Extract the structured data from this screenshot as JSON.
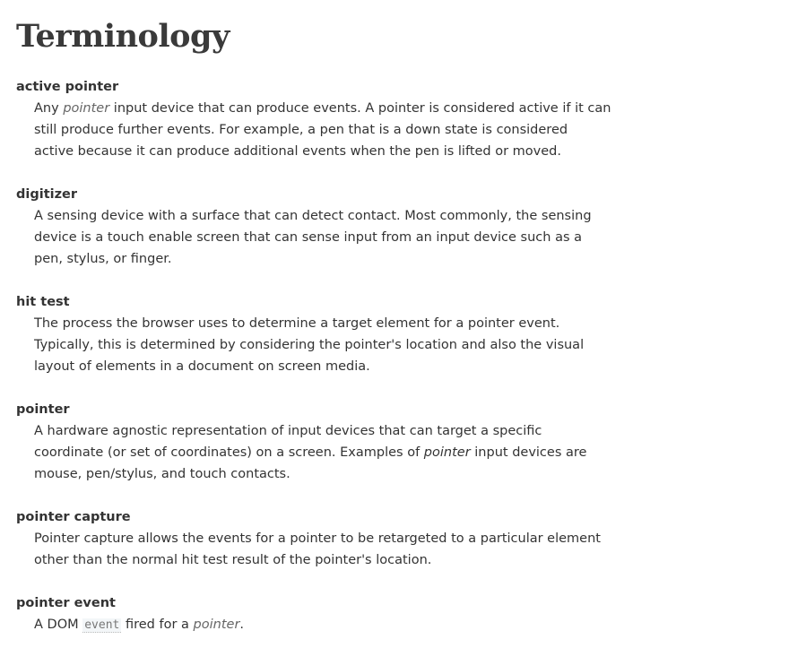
{
  "title": "Terminology",
  "terms": [
    {
      "term": "active pointer",
      "lines": [
        [
          {
            "t": "Any "
          },
          {
            "t": "pointer",
            "s": "link"
          },
          {
            "t": " input device that can produce events. A pointer is considered active if it can"
          }
        ],
        [
          {
            "t": "still produce further events. For example, a pen that is a down state is considered"
          }
        ],
        [
          {
            "t": "active because it can produce additional events when the pen is lifted or moved."
          }
        ]
      ]
    },
    {
      "term": "digitizer",
      "lines": [
        [
          {
            "t": "A sensing device with a surface that can detect contact. Most commonly, the sensing"
          }
        ],
        [
          {
            "t": "device is a touch enable screen that can sense input from an input device such as a"
          }
        ],
        [
          {
            "t": "pen, stylus, or finger."
          }
        ]
      ]
    },
    {
      "term": "hit test",
      "lines": [
        [
          {
            "t": "The process the browser uses to determine a target element for a pointer event."
          }
        ],
        [
          {
            "t": "Typically, this is determined by considering the pointer's location and also the visual"
          }
        ],
        [
          {
            "t": "layout of elements in a document on screen media."
          }
        ]
      ]
    },
    {
      "term": "pointer",
      "lines": [
        [
          {
            "t": "A hardware agnostic representation of input devices that can target a specific"
          }
        ],
        [
          {
            "t": "coordinate (or set of coordinates) on a screen. Examples of "
          },
          {
            "t": "pointer",
            "s": "em"
          },
          {
            "t": " input devices are"
          }
        ],
        [
          {
            "t": "mouse, pen/stylus, and touch contacts."
          }
        ]
      ]
    },
    {
      "term": "pointer capture",
      "lines": [
        [
          {
            "t": "Pointer capture allows the events for a pointer to be retargeted to a particular element"
          }
        ],
        [
          {
            "t": "other than the normal hit test result of the pointer's location."
          }
        ]
      ]
    },
    {
      "term": "pointer event",
      "lines": [
        [
          {
            "t": "A DOM "
          },
          {
            "t": "event",
            "s": "code"
          },
          {
            "t": " fired for a "
          },
          {
            "t": "pointer",
            "s": "link"
          },
          {
            "t": "."
          }
        ]
      ]
    }
  ]
}
